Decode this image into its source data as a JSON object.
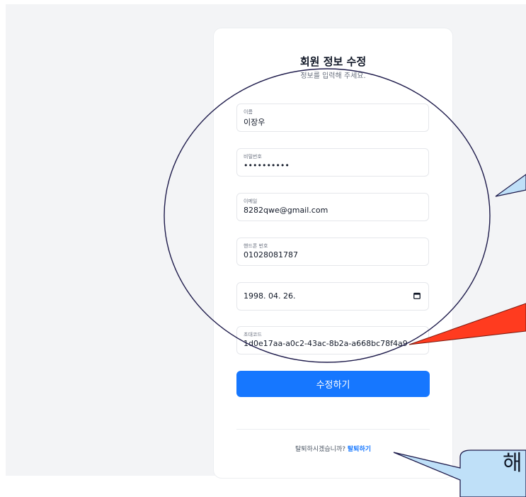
{
  "form": {
    "title": "회원 정보 수정",
    "subtitle": "정보를 입력해 주세요.",
    "fields": [
      {
        "label": "이름",
        "value": "이장우"
      },
      {
        "label": "비밀번호",
        "value": "••••••••••"
      },
      {
        "label": "이메일",
        "value": "8282qwe@gmail.com"
      },
      {
        "label": "핸드폰 번호",
        "value": "01028081787"
      },
      {
        "label": "",
        "value": "1998. 04. 26."
      },
      {
        "label": "초대코드",
        "value": "1d0e17aa-a0c2-43ac-8b2a-a668bc78f4a9"
      }
    ],
    "submit_label": "수정하기",
    "footer_prompt": "탈퇴하시겠습니까?",
    "footer_link": "탈퇴하기"
  },
  "annotations": {
    "callout_text": "해"
  },
  "colors": {
    "accent": "#1677ff",
    "page_background": "#f3f4f6",
    "annotation_outline": "#1e1b4b",
    "callout_blue_fill": "#bfe0f8",
    "callout_red_fill": "#ff3b1f"
  },
  "icons": {
    "date_picker": "calendar-icon"
  }
}
